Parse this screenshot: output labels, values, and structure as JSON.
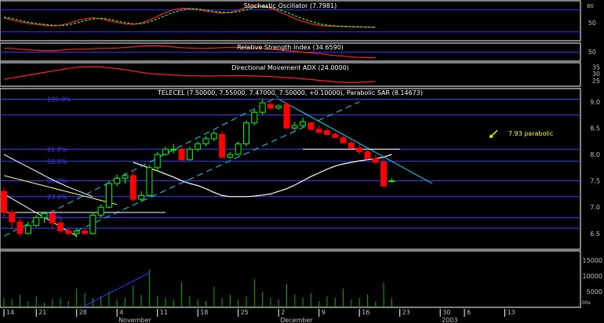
{
  "chart_data": {
    "type": "candlestick",
    "background": "#000000",
    "panels": {
      "stochastic": {
        "label": "Stochastic Oscillator (7.7981)",
        "axis_labels": [
          "80",
          "50"
        ],
        "levels": [
          80,
          20
        ],
        "k": [
          58,
          52,
          47,
          43,
          40,
          38,
          36,
          38,
          43,
          50,
          55,
          58,
          55,
          50,
          45,
          42,
          40,
          44,
          52,
          62,
          72,
          80,
          84,
          83,
          80,
          76,
          73,
          71,
          73,
          79,
          86,
          90,
          89,
          84,
          76,
          66,
          56,
          48,
          42,
          38,
          36,
          35,
          34,
          34,
          33,
          33,
          32
        ],
        "d": [
          60,
          56,
          51,
          46,
          43,
          40,
          38,
          37,
          39,
          44,
          50,
          55,
          57,
          54,
          49,
          45,
          42,
          42,
          47,
          55,
          64,
          73,
          79,
          83,
          82,
          79,
          76,
          73,
          72,
          75,
          80,
          86,
          89,
          87,
          81,
          73,
          64,
          55,
          48,
          42,
          38,
          36,
          35,
          34,
          34,
          33,
          33
        ],
        "colors": {
          "k": "#ff2020",
          "d": "#30ff30"
        }
      },
      "rsi": {
        "label": "Relative Strength Index (34.6590)",
        "axis_labels": [
          "50"
        ],
        "values": [
          60,
          60,
          58,
          56,
          55,
          54,
          54,
          55,
          57,
          58,
          58,
          59,
          60,
          60,
          61,
          63,
          64,
          66,
          67,
          67,
          66,
          64,
          62,
          61,
          60,
          60,
          61,
          62,
          63,
          63,
          62,
          61,
          60,
          58,
          56,
          54,
          52,
          50,
          48,
          46,
          43,
          41,
          39,
          37,
          36,
          35,
          35
        ],
        "color": "#ff2020"
      },
      "adx": {
        "label": "Directional Movement ADX (24.0000)",
        "axis_labels": [
          "35",
          "30",
          "25"
        ],
        "values": [
          26,
          27,
          28,
          29,
          30,
          31,
          32,
          33,
          34,
          34.8,
          35,
          35.2,
          35,
          34.5,
          33.8,
          33,
          32,
          31,
          30.2,
          29.8,
          29.4,
          29,
          28.8,
          28.6,
          28.5,
          28.4,
          28.4,
          28.5,
          28.6,
          28.7,
          28.6,
          28.4,
          28.2,
          28,
          27.6,
          27.2,
          26.8,
          26.3,
          25.8,
          25.2,
          24.6,
          24.1,
          23.8,
          23.7,
          23.8,
          24,
          24.4
        ],
        "color": "#ff2020"
      },
      "price": {
        "label": "TELECEL (7.50000, 7.55000, 7.47000, 7.50000, +0.10000), Parabolic SAR (8.14673)",
        "y_axis_ticks": [
          "9.0",
          "8.5",
          "8.0",
          "7.5",
          "7.0",
          "6.5"
        ],
        "ylim": [
          6.2,
          9.25
        ],
        "fib_levels": [
          {
            "label": "100.0%",
            "value": 9.05
          },
          {
            "label": "61.8%",
            "value": 8.1
          },
          {
            "label": "50.0%",
            "value": 7.87
          },
          {
            "label": "38.2%",
            "value": 7.5
          },
          {
            "label": "23.6%",
            "value": 7.2
          },
          {
            "label": "0.0%",
            "value": 6.8
          },
          {
            "label": "",
            "value": 8.75
          },
          {
            "label": "",
            "value": 6.6
          }
        ],
        "annotation": "7.93 parabolic",
        "annotation_value": 8.4,
        "candles": [
          [
            7.3,
            7.38,
            6.82,
            6.9
          ],
          [
            6.9,
            6.95,
            6.6,
            6.72
          ],
          [
            6.72,
            6.8,
            6.45,
            6.5
          ],
          [
            6.5,
            6.72,
            6.48,
            6.65
          ],
          [
            6.65,
            6.85,
            6.62,
            6.8
          ],
          [
            6.8,
            6.92,
            6.7,
            6.88
          ],
          [
            6.88,
            6.95,
            6.6,
            6.7
          ],
          [
            6.7,
            6.75,
            6.5,
            6.55
          ],
          [
            6.55,
            6.62,
            6.45,
            6.5
          ],
          [
            6.5,
            6.6,
            6.42,
            6.55
          ],
          [
            6.55,
            6.62,
            6.48,
            6.5
          ],
          [
            6.5,
            6.9,
            6.48,
            6.85
          ],
          [
            6.85,
            7.05,
            6.8,
            7.0
          ],
          [
            7.0,
            7.5,
            6.98,
            7.45
          ],
          [
            7.45,
            7.62,
            7.4,
            7.55
          ],
          [
            7.55,
            7.65,
            7.45,
            7.6
          ],
          [
            7.6,
            7.7,
            7.1,
            7.15
          ],
          [
            7.15,
            7.3,
            7.1,
            7.22
          ],
          [
            7.22,
            7.8,
            7.2,
            7.75
          ],
          [
            7.75,
            8.05,
            7.7,
            8.0
          ],
          [
            8.0,
            8.15,
            7.98,
            8.1
          ],
          [
            8.1,
            8.2,
            8.02,
            8.1
          ],
          [
            8.1,
            8.15,
            7.88,
            7.9
          ],
          [
            7.9,
            8.15,
            7.88,
            8.1
          ],
          [
            8.1,
            8.25,
            8.05,
            8.2
          ],
          [
            8.2,
            8.35,
            8.15,
            8.3
          ],
          [
            8.3,
            8.45,
            8.25,
            8.4
          ],
          [
            8.38,
            8.45,
            7.92,
            7.95
          ],
          [
            7.95,
            8.05,
            7.92,
            8.0
          ],
          [
            8.0,
            8.25,
            7.98,
            8.2
          ],
          [
            8.2,
            8.65,
            8.15,
            8.6
          ],
          [
            8.6,
            8.85,
            8.55,
            8.8
          ],
          [
            8.8,
            9.05,
            8.75,
            8.98
          ],
          [
            8.95,
            9.05,
            8.85,
            8.88
          ],
          [
            8.88,
            8.95,
            8.85,
            8.92
          ],
          [
            8.95,
            8.98,
            8.7,
            8.5
          ],
          [
            8.5,
            8.62,
            8.45,
            8.55
          ],
          [
            8.55,
            8.7,
            8.5,
            8.62
          ],
          [
            8.6,
            8.62,
            8.45,
            8.48
          ],
          [
            8.48,
            8.55,
            8.4,
            8.42
          ],
          [
            8.45,
            8.5,
            8.35,
            8.38
          ],
          [
            8.38,
            8.42,
            8.3,
            8.32
          ],
          [
            8.32,
            8.35,
            8.2,
            8.22
          ],
          [
            8.22,
            8.28,
            8.1,
            8.12
          ],
          [
            8.12,
            8.2,
            8.0,
            8.05
          ],
          [
            8.05,
            8.1,
            7.9,
            7.92
          ],
          [
            7.92,
            8.0,
            7.82,
            7.85
          ],
          [
            7.85,
            7.95,
            7.5,
            7.4
          ],
          [
            7.5,
            7.55,
            7.47,
            7.5
          ]
        ],
        "moving_average_1": [
          7.85,
          7.8,
          7.74,
          7.69,
          7.63,
          7.57,
          7.5,
          7.45,
          7.41,
          7.35,
          7.28,
          7.22,
          7.2,
          7.2,
          7.2,
          7.21,
          7.23,
          7.25,
          7.3,
          7.35,
          7.42,
          7.5,
          7.58,
          7.65,
          7.72,
          7.78,
          7.82,
          7.85,
          7.88,
          7.9,
          7.92,
          7.95,
          8.0
        ],
        "moving_average_2": [
          8.0,
          7.92,
          7.84,
          7.76,
          7.68,
          7.6,
          7.52,
          7.45,
          7.38,
          7.32,
          7.26,
          7.2
        ],
        "trendlines": [
          {
            "color": "#00d8ff",
            "dashed": true,
            "from": [
              0,
              6.45
            ],
            "to": [
              34,
              9.1
            ]
          },
          {
            "color": "#00d8ff",
            "dashed": true,
            "from": [
              9,
              6.55
            ],
            "to": [
              44,
              9.0
            ]
          },
          {
            "color": "#00d8ff",
            "dashed": false,
            "from": [
              34,
              9.05
            ],
            "to": [
              53,
              7.45
            ]
          },
          {
            "color": "#ffffff",
            "dashed": false,
            "from": [
              0,
              7.25
            ],
            "to": [
              9,
              6.45
            ]
          },
          {
            "color": "#ffff66",
            "dashed": false,
            "from": [
              0,
              7.6
            ],
            "to": [
              14,
              7.05
            ]
          },
          {
            "color": "#ffffff",
            "dashed": false,
            "from": [
              0,
              6.9
            ],
            "to": [
              20,
              6.9
            ]
          },
          {
            "color": "#ffffff",
            "dashed": false,
            "from": [
              37,
              8.1
            ],
            "to": [
              49,
              8.1
            ]
          }
        ]
      },
      "volume": {
        "axis_labels": [
          "15000",
          "10000",
          "5000",
          "100s"
        ],
        "ylim": [
          0,
          18000
        ],
        "values": [
          3000,
          2500,
          4000,
          2000,
          3500,
          1500,
          2500,
          3000,
          2000,
          6000,
          4500,
          3000,
          3500,
          5000,
          2500,
          3000,
          7000,
          4000,
          12000,
          3500,
          3000,
          2500,
          8000,
          3500,
          2500,
          2000,
          6500,
          3000,
          4000,
          2500,
          3500,
          9000,
          5000,
          3000,
          2500,
          7500,
          4000,
          3000,
          4500,
          2000,
          3500,
          3000,
          6000,
          2500,
          3000,
          4000,
          2000,
          8000,
          3000
        ],
        "trendline": {
          "from": [
            10,
            500
          ],
          "to": [
            18,
            11000
          ]
        }
      }
    },
    "x_axis": {
      "ticks": [
        {
          "label": "14",
          "idx": 0
        },
        {
          "label": "21",
          "idx": 4
        },
        {
          "label": "28",
          "idx": 9
        },
        {
          "label": "4",
          "idx": 14
        },
        {
          "label": "11",
          "idx": 19
        },
        {
          "label": "18",
          "idx": 24
        },
        {
          "label": "25",
          "idx": 29
        },
        {
          "label": "2",
          "idx": 34
        },
        {
          "label": "9",
          "idx": 39
        },
        {
          "label": "16",
          "idx": 44
        },
        {
          "label": "23",
          "idx": 49
        },
        {
          "label": "30",
          "idx": 54
        },
        {
          "label": "6",
          "idx": 57
        },
        {
          "label": "13",
          "idx": 62
        }
      ],
      "months": [
        {
          "label": "November",
          "idx": 14
        },
        {
          "label": "December",
          "idx": 34
        },
        {
          "label": "2003",
          "idx": 54
        }
      ]
    },
    "colors": {
      "up": "#00ff00",
      "down": "#ff0000",
      "grid": "#3030ff",
      "fib": "#4040ff",
      "ma": "#ffffff",
      "panel_border": "#ffffff",
      "axis_text": "#c0c0c0",
      "volume": "#00b000",
      "annotation": "#ffff00"
    }
  }
}
